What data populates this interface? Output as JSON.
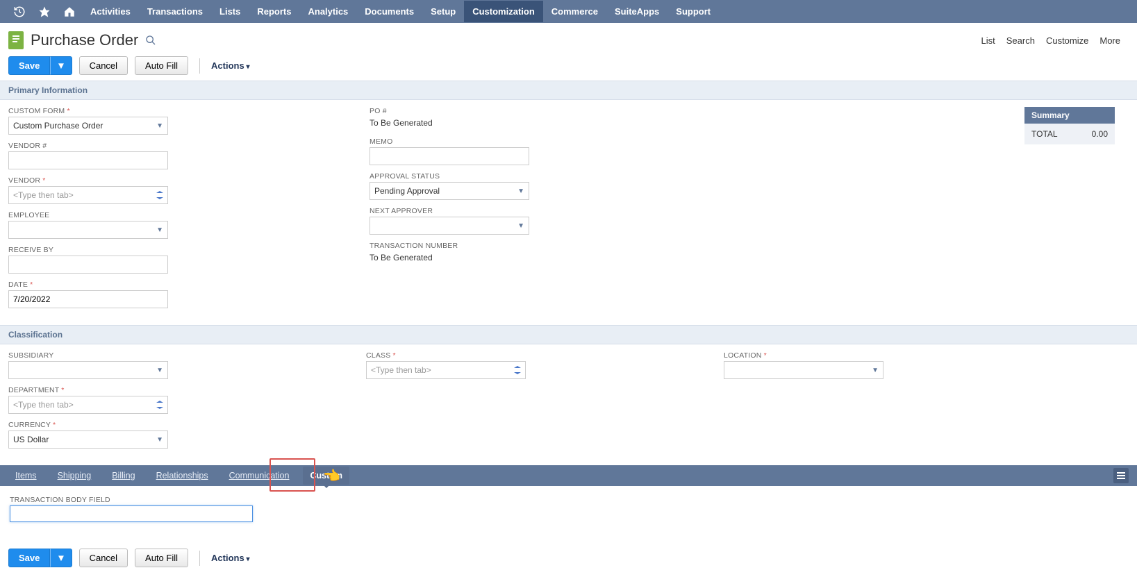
{
  "nav": {
    "items": [
      "Activities",
      "Transactions",
      "Lists",
      "Reports",
      "Analytics",
      "Documents",
      "Setup",
      "Customization",
      "Commerce",
      "SuiteApps",
      "Support"
    ],
    "activeIndex": 7
  },
  "header": {
    "title": "Purchase Order",
    "links": [
      "List",
      "Search",
      "Customize",
      "More"
    ]
  },
  "buttons": {
    "save": "Save",
    "cancel": "Cancel",
    "autofill": "Auto Fill",
    "actions": "Actions"
  },
  "sections": {
    "primary": "Primary Information",
    "classification": "Classification"
  },
  "primary": {
    "customForm": {
      "label": "CUSTOM FORM",
      "value": "Custom Purchase Order"
    },
    "vendorNum": {
      "label": "VENDOR #",
      "value": ""
    },
    "vendor": {
      "label": "VENDOR",
      "placeholder": "<Type then tab>"
    },
    "employee": {
      "label": "EMPLOYEE",
      "value": ""
    },
    "receiveBy": {
      "label": "RECEIVE BY",
      "value": ""
    },
    "date": {
      "label": "DATE",
      "value": "7/20/2022"
    },
    "poNum": {
      "label": "PO #",
      "value": "To Be Generated"
    },
    "memo": {
      "label": "MEMO",
      "value": ""
    },
    "approval": {
      "label": "APPROVAL STATUS",
      "value": "Pending Approval"
    },
    "nextApprover": {
      "label": "NEXT APPROVER",
      "value": ""
    },
    "transNum": {
      "label": "TRANSACTION NUMBER",
      "value": "To Be Generated"
    }
  },
  "summary": {
    "title": "Summary",
    "totalLabel": "TOTAL",
    "totalValue": "0.00"
  },
  "classification": {
    "subsidiary": {
      "label": "SUBSIDIARY",
      "value": ""
    },
    "department": {
      "label": "DEPARTMENT",
      "placeholder": "<Type then tab>"
    },
    "currency": {
      "label": "CURRENCY",
      "value": "US Dollar"
    },
    "class": {
      "label": "CLASS",
      "placeholder": "<Type then tab>"
    },
    "location": {
      "label": "LOCATION",
      "value": ""
    }
  },
  "subtabs": {
    "items": [
      "Items",
      "Shipping",
      "Billing",
      "Relationships",
      "Communication",
      "Custom"
    ],
    "activeIndex": 5
  },
  "customTab": {
    "field1": {
      "label": "TRANSACTION BODY FIELD",
      "value": ""
    }
  }
}
